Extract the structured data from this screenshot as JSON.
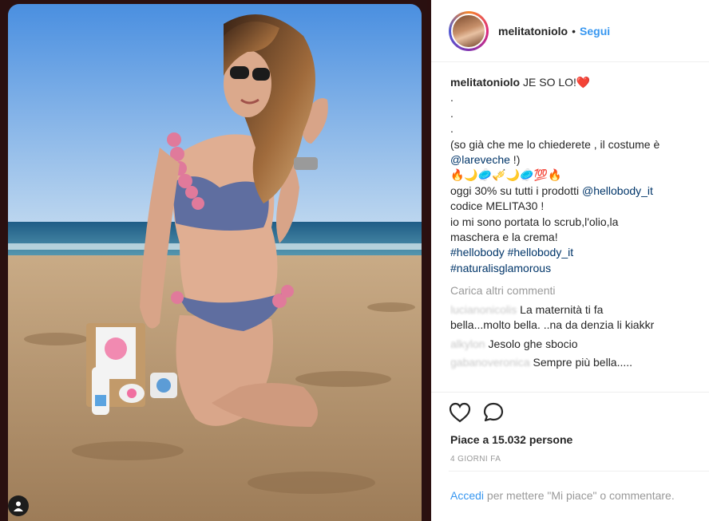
{
  "header": {
    "username": "melitatoniolo",
    "separator": "•",
    "follow_label": "Segui"
  },
  "caption": {
    "username": "melitatoniolo",
    "text": "JE SO LO!❤️",
    "dots": [
      ".",
      ".",
      "."
    ],
    "line1": "(so già che me lo chiederete , il costume è",
    "mention1": "@lareveche",
    "mention1_suffix": " !)",
    "emoji_line": "🔥🌙🥏🎺🌙🥏💯🔥",
    "line2": "oggi 30% su tutti i prodotti ",
    "mention2": "@hellobody_it",
    "line3": "codice MELITA30 !",
    "line4": "io mi sono portata lo scrub,l'olio,la",
    "line5": "maschera e la crema!",
    "hashtags1": "#hellobody #hellobody_it",
    "hashtags2": "#naturalisglamorous"
  },
  "load_more_label": "Carica altri commenti",
  "comments": [
    {
      "username": "lucianonicolis",
      "text": "La maternità ti fa",
      "text2": "bella...molto bella. ..na da denzia li kiakkr"
    },
    {
      "username": "alkylon",
      "text": "Jesolo ghe sbocio"
    },
    {
      "username": "gabanoveronica",
      "text": "Sempre più bella....."
    }
  ],
  "actions": {
    "like_icon": "heart-icon",
    "comment_icon": "comment-icon",
    "likes_text": "Piace a 15.032 persone",
    "time_text": "4 GIORNI FA"
  },
  "login": {
    "link": "Accedi",
    "rest": " per mettere \"Mi piace\" o commentare."
  },
  "colors": {
    "accent": "#3897f0",
    "mention": "#003569",
    "muted": "#999999",
    "background_dark": "#2a1010"
  }
}
